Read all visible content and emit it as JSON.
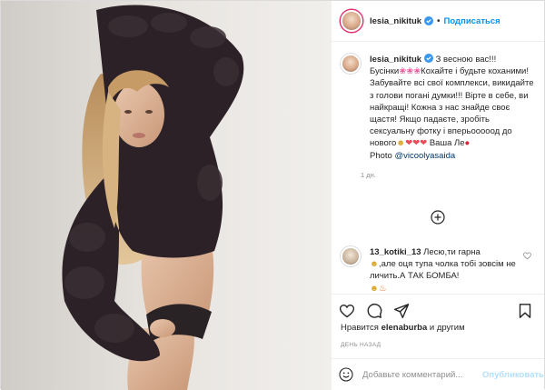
{
  "post": {
    "author": "lesia_nikituk",
    "follow_label": "Подписаться",
    "dot": "•"
  },
  "caption": {
    "author": "lesia_nikituk",
    "segments": {
      "s1": " З весною вас!!! Бусінки",
      "s2": "Кохайте і будьте коханими! Забувайте всі свої комплекси, викидайте з голови погані думки!!! Вірте в себе, ви найкращі! Кожна з нас знайде своє щастя! Якщо падаєте, зробіть сексуальну фотку і вперьооооод до нового",
      "s3": " Ваша Ле",
      "photo_prefix": "Photo ",
      "mention": "@vicoolyasaida"
    },
    "emoji": {
      "flower": "❀",
      "heart": "❤",
      "smile": "☻",
      "strawberry": "●"
    },
    "time": "1 дн."
  },
  "comment": {
    "author": "13_kotiki_13",
    "line1": " Лесю,ти гарна",
    "line2": ",але оця тупа чолка тобі зовсім не личить.А ТАК БОМБА!",
    "emoji": {
      "face": "☻",
      "fire": "♨"
    }
  },
  "likes": {
    "prefix": "Нравится ",
    "user": "elenaburba",
    "suffix": " и другим"
  },
  "date_label": "ДЕНЬ НАЗАД",
  "add_comment": {
    "placeholder": "Добавьте комментарий...",
    "publish_label": "Опубликовать"
  },
  "colors": {
    "link_blue": "#0095f6",
    "heart_red": "#ed4956",
    "muted": "#8e8e8e",
    "border": "#dbdbdb",
    "story_ring": "#e1306c"
  },
  "icons": [
    "verified-badge-icon",
    "plus-circle-icon",
    "heart-outline-icon",
    "comment-icon",
    "share-icon",
    "bookmark-icon",
    "smiley-icon"
  ]
}
